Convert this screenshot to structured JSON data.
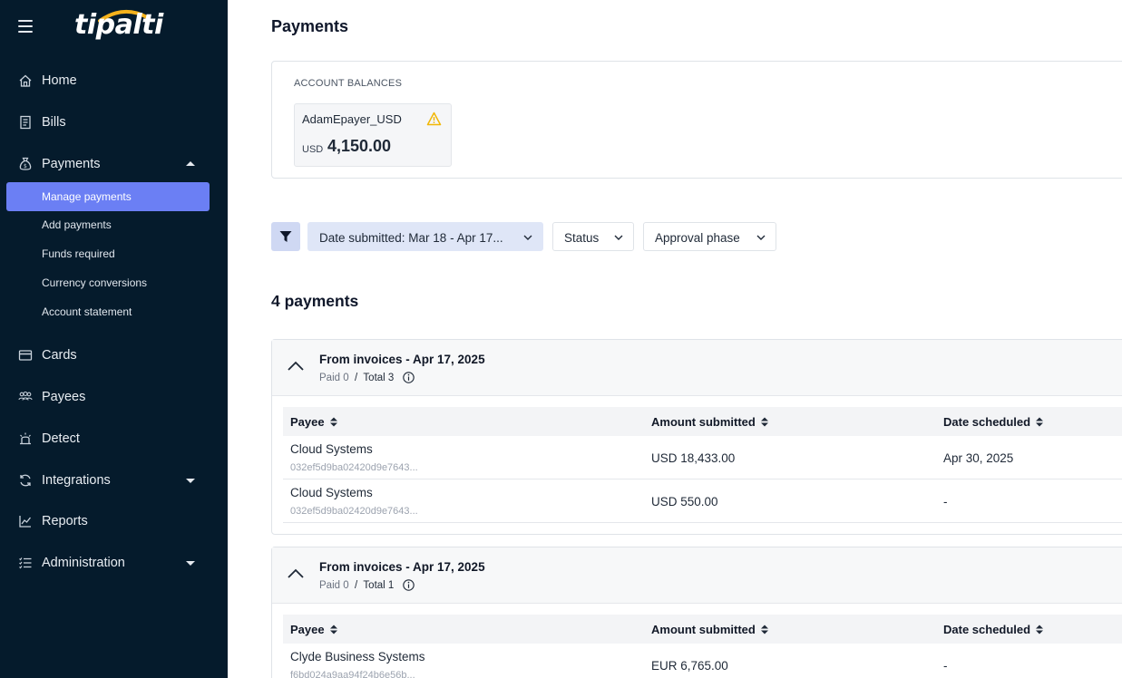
{
  "sidebar": {
    "brand": "tipalti",
    "nav": [
      {
        "label": "Home",
        "icon": "home-icon"
      },
      {
        "label": "Bills",
        "icon": "bills-icon"
      },
      {
        "label": "Payments",
        "icon": "money-bag-icon"
      },
      {
        "label": "Cards",
        "icon": "card-icon"
      },
      {
        "label": "Payees",
        "icon": "people-icon"
      },
      {
        "label": "Detect",
        "icon": "alarm-icon"
      },
      {
        "label": "Integrations",
        "icon": "sync-icon"
      },
      {
        "label": "Reports",
        "icon": "chart-icon"
      },
      {
        "label": "Administration",
        "icon": "checklist-icon"
      }
    ],
    "payments_sub": [
      {
        "label": "Manage payments",
        "active": true
      },
      {
        "label": "Add payments"
      },
      {
        "label": "Funds required"
      },
      {
        "label": "Currency conversions"
      },
      {
        "label": "Account statement"
      }
    ]
  },
  "main": {
    "title": "Payments",
    "balances": {
      "heading": "ACCOUNT BALANCES",
      "account_name": "AdamEpayer_USD",
      "currency": "USD",
      "amount": "4,150.00"
    },
    "filters": {
      "date": "Date submitted:  Mar 18 - Apr 17...",
      "status": "Status",
      "approval": "Approval phase"
    },
    "count_title": "4 payments",
    "groups": [
      {
        "title": "From invoices - Apr 17, 2025",
        "paid_label": "Paid",
        "paid": "0",
        "sep": "/",
        "total_label": "Total",
        "total": "3",
        "columns": [
          "Payee",
          "Amount submitted",
          "Date scheduled"
        ],
        "rows": [
          {
            "payee": "Cloud Systems",
            "id": "032ef5d9ba02420d9e7643...",
            "amount": "USD 18,433.00",
            "date": "Apr 30, 2025"
          },
          {
            "payee": "Cloud Systems",
            "id": "032ef5d9ba02420d9e7643...",
            "amount": "USD 550.00",
            "date": "-"
          }
        ]
      },
      {
        "title": "From invoices - Apr 17, 2025",
        "paid_label": "Paid",
        "paid": "0",
        "sep": "/",
        "total_label": "Total",
        "total": "1",
        "columns": [
          "Payee",
          "Amount submitted",
          "Date scheduled"
        ],
        "rows": [
          {
            "payee": "Clyde Business Systems",
            "id": "f6bd024a9aa94f24b6e56b...",
            "amount": "EUR 6,765.00",
            "date": "-"
          }
        ]
      }
    ]
  }
}
